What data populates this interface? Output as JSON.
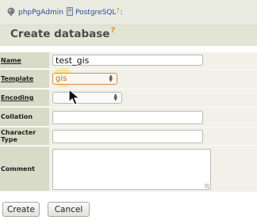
{
  "breadcrumb": {
    "app": "phpPgAdmin",
    "server": "PostgreSQL",
    "server_help": "?",
    "separator": ":"
  },
  "page": {
    "title": "Create database",
    "help": "?"
  },
  "form": {
    "name": {
      "label": "Name",
      "value": "test_gis"
    },
    "template": {
      "label": "Template",
      "value": "gis"
    },
    "encoding": {
      "label": "Encoding",
      "value": ""
    },
    "collation": {
      "label": "Collation",
      "value": ""
    },
    "character_type": {
      "label": "Character Type",
      "value": ""
    },
    "comment": {
      "label": "Comment",
      "value": ""
    }
  },
  "buttons": {
    "create": "Create",
    "cancel": "Cancel"
  },
  "colors": {
    "link": "#2a4b9b",
    "help": "#e0971f",
    "label_bg": "#d8dbc8",
    "focus_border": "#d98a55"
  },
  "icons": [
    "elephant-icon",
    "server-icon",
    "mouse-cursor-icon"
  ]
}
